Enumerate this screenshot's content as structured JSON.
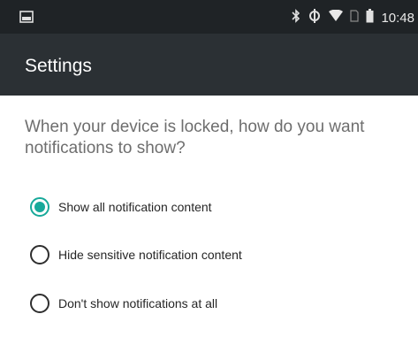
{
  "status_bar": {
    "time": "10:48",
    "icons": [
      "screenshot-icon",
      "bluetooth-icon",
      "sync-icon",
      "wifi-icon",
      "sim-icon",
      "battery-icon"
    ]
  },
  "app_bar": {
    "title": "Settings"
  },
  "dialog": {
    "question": "When your device is locked, how do you want notifications to show?",
    "options": [
      {
        "label": "Show all notification content",
        "selected": true
      },
      {
        "label": "Hide sensitive notification content",
        "selected": false
      },
      {
        "label": "Don't show notifications at all",
        "selected": false
      }
    ]
  },
  "colors": {
    "accent": "#17a99a",
    "status_bar": "#1f2326",
    "app_bar": "#2b3034"
  }
}
